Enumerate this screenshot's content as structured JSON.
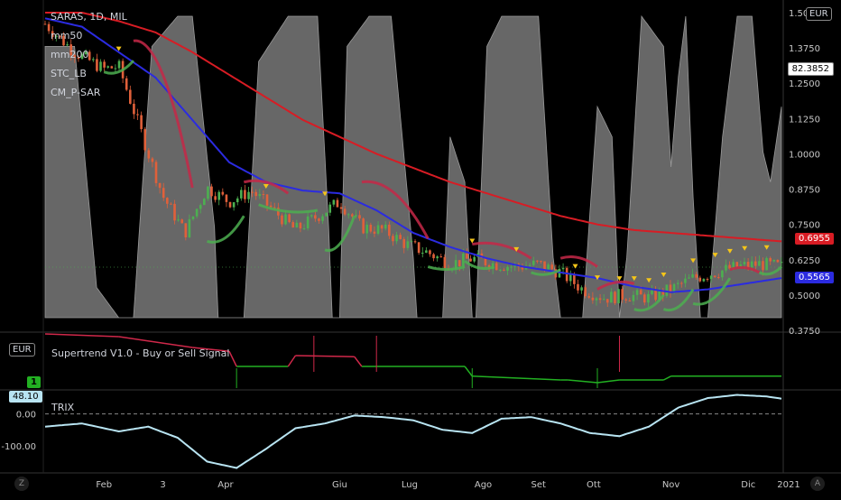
{
  "main_legend": {
    "symbol": "SARAS, 1D, MIL",
    "indicators": [
      "mm50",
      "mm200",
      "STC_LB",
      "CM_P-SAR"
    ]
  },
  "currency_button": "EUR",
  "pane1_currency": "EUR",
  "price_tags": {
    "stc_value": "82.3852",
    "mm200_value": "0.6955",
    "mm50_value": "0.5565"
  },
  "supertrend_pane": {
    "title": "Supertrend V1.0 - Buy or Sell Signal",
    "value_tag": "1"
  },
  "trix_pane": {
    "title": "TRIX",
    "value_tag": "48.10"
  },
  "buttons": {
    "corner_left": "Z",
    "corner_right": "A"
  },
  "colors": {
    "mm50": "#2b2be0",
    "mm200": "#d81c24",
    "stc_fill": "#8a8a8a",
    "sar_up": "#4caf50",
    "sar_down": "#c62848",
    "candle_up": "#4caf50",
    "candle_down": "#e0603a",
    "trix": "#b8e4f2",
    "supertrend_up": "#22b022",
    "supertrend_down": "#d0284a",
    "triangle": "#f5c518"
  },
  "chart_data": [
    {
      "type": "line",
      "name": "SARAS, 1D, MIL",
      "x_tick_labels": [
        "Feb",
        "3",
        "Apr",
        "Giu",
        "Lug",
        "Ago",
        "Set",
        "Ott",
        "Nov",
        "Dic",
        "2021"
      ],
      "y_tick_labels": [
        "1.5000",
        "1.3750",
        "1.2500",
        "1.1250",
        "1.0000",
        "0.8750",
        "0.7500",
        "0.6250",
        "0.5000",
        "0.3750"
      ],
      "ylim": [
        0.375,
        1.5
      ],
      "grid": false,
      "series": [
        {
          "name": "mm50",
          "x": [
            0,
            0.05,
            0.1,
            0.15,
            0.2,
            0.25,
            0.3,
            0.35,
            0.4,
            0.45,
            0.5,
            0.55,
            0.6,
            0.65,
            0.7,
            0.75,
            0.8,
            0.85,
            0.9,
            0.95,
            1.0
          ],
          "values": [
            1.48,
            1.45,
            1.36,
            1.27,
            1.12,
            0.97,
            0.9,
            0.87,
            0.86,
            0.8,
            0.72,
            0.67,
            0.63,
            0.6,
            0.58,
            0.56,
            0.53,
            0.51,
            0.52,
            0.54,
            0.56
          ]
        },
        {
          "name": "mm200",
          "x": [
            0,
            0.05,
            0.1,
            0.15,
            0.2,
            0.25,
            0.3,
            0.35,
            0.4,
            0.45,
            0.5,
            0.55,
            0.6,
            0.65,
            0.7,
            0.75,
            0.8,
            0.85,
            0.9,
            0.95,
            1.0
          ],
          "values": [
            1.5,
            1.5,
            1.47,
            1.43,
            1.36,
            1.28,
            1.2,
            1.12,
            1.06,
            1.0,
            0.95,
            0.9,
            0.86,
            0.82,
            0.78,
            0.75,
            0.73,
            0.72,
            0.71,
            0.7,
            0.69
          ]
        },
        {
          "name": "price",
          "x": [
            0,
            0.04,
            0.08,
            0.1,
            0.13,
            0.16,
            0.19,
            0.22,
            0.25,
            0.28,
            0.31,
            0.34,
            0.37,
            0.4,
            0.43,
            0.46,
            0.49,
            0.52,
            0.55,
            0.58,
            0.61,
            0.64,
            0.67,
            0.7,
            0.73,
            0.76,
            0.79,
            0.82,
            0.85,
            0.88,
            0.91,
            0.94,
            0.97,
            1.0
          ],
          "values": [
            1.46,
            1.36,
            1.3,
            1.31,
            1.08,
            0.85,
            0.72,
            0.88,
            0.83,
            0.87,
            0.8,
            0.73,
            0.78,
            0.83,
            0.74,
            0.73,
            0.68,
            0.65,
            0.61,
            0.63,
            0.61,
            0.6,
            0.61,
            0.58,
            0.52,
            0.49,
            0.5,
            0.49,
            0.52,
            0.56,
            0.58,
            0.6,
            0.61,
            0.6
          ]
        }
      ]
    },
    {
      "type": "line",
      "name": "Supertrend V1.0 - Buy or Sell Signal",
      "series": [
        {
          "name": "Supertrend",
          "x": [
            0,
            0.1,
            0.2,
            0.25,
            0.26,
            0.33,
            0.34,
            0.42,
            0.43,
            0.57,
            0.58,
            0.7,
            0.71,
            0.75,
            0.78,
            0.84,
            0.85,
            1.0
          ],
          "values": [
            1.0,
            0.95,
            0.75,
            0.68,
            0.4,
            0.4,
            0.6,
            0.58,
            0.4,
            0.4,
            0.22,
            0.15,
            0.15,
            0.1,
            0.15,
            0.15,
            0.22,
            0.22
          ]
        }
      ]
    },
    {
      "type": "line",
      "name": "TRIX",
      "y_tick_labels": [
        "0.00",
        "-100.00"
      ],
      "ylim": [
        -180,
        70
      ],
      "series": [
        {
          "name": "TRIX",
          "x": [
            0,
            0.05,
            0.1,
            0.14,
            0.18,
            0.22,
            0.26,
            0.3,
            0.34,
            0.38,
            0.42,
            0.46,
            0.5,
            0.54,
            0.58,
            0.62,
            0.66,
            0.7,
            0.74,
            0.78,
            0.82,
            0.86,
            0.9,
            0.94,
            0.98,
            1.0
          ],
          "values": [
            -40,
            -30,
            -55,
            -40,
            -75,
            -150,
            -170,
            -110,
            -45,
            -30,
            -5,
            -10,
            -20,
            -50,
            -60,
            -15,
            -10,
            -30,
            -60,
            -70,
            -40,
            20,
            50,
            60,
            55,
            48
          ]
        }
      ]
    }
  ]
}
